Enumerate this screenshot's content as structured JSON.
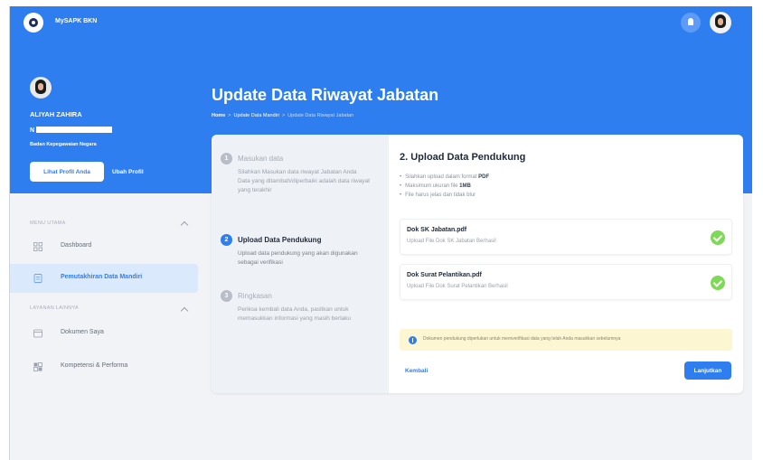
{
  "app": {
    "brand": "MySAPK BKN"
  },
  "profile": {
    "name": "ALIYAH ZAHIRA",
    "id_prefix": "N",
    "org": "Badan Kepegawaian Negara",
    "view_button": "Lihat Profil Anda",
    "edit_button": "Ubah Profil"
  },
  "menu": {
    "section1": "MENU UTAMA",
    "items1": [
      {
        "label": "Dashboard",
        "icon": "grid-icon"
      },
      {
        "label": "Pemutakhiran Data Mandiri",
        "icon": "document-icon",
        "active": true
      }
    ],
    "section2": "LAYANAN LAINNYA",
    "items2": [
      {
        "label": "Dokumen Saya",
        "icon": "folder-icon"
      },
      {
        "label": "Kompetensi & Performa",
        "icon": "chart-icon"
      }
    ]
  },
  "page": {
    "title": "Update Data Riwayat Jabatan",
    "breadcrumb": [
      "Home",
      "Update Data Mandiri",
      "Update Data Riwayat Jabatan"
    ]
  },
  "steps": [
    {
      "num": "1",
      "title": "Masukan data",
      "desc": [
        "Silahkan Masukan data riwayat Jabatan Anda",
        "Data yang ditambah/diperbaiki adalah data riwayat yang terakhir"
      ]
    },
    {
      "num": "2",
      "title": "Upload Data Pendukung",
      "desc": [
        "Upload data pendukung yang akan digunakan sebagai verifikasi"
      ],
      "active": true
    },
    {
      "num": "3",
      "title": "Ringkasan",
      "desc": [
        "Periksa kembali data Anda, pastikan untuk memasukkan informasi yang masih berlaku"
      ]
    }
  ],
  "upload": {
    "title": "2. Upload Data Pendukung",
    "requirements": [
      {
        "text": "Silahkan upload dalam format ",
        "bold": "PDF"
      },
      {
        "text": "Maksimum ukuran file ",
        "bold": "1MB"
      },
      {
        "text": "File harus jelas dan tidak blur",
        "bold": ""
      }
    ],
    "documents": [
      {
        "title": "Dok SK Jabatan.pdf",
        "subtitle": "Upload File Dok SK Jabatan Berhasil",
        "status": "success"
      },
      {
        "title": "Dok Surat Pelantikan.pdf",
        "subtitle": "Upload File Dok Surat Pelantikan Berhasil",
        "status": "success"
      }
    ],
    "notice": "Dokumen pendukung diperlukan untuk memverifikasi data yang telah Anda masukkan sebelumnya",
    "back": "Kembali",
    "next": "Lanjutkan"
  },
  "colors": {
    "primary": "#2f7ef0",
    "success": "#7ed957",
    "notice_bg": "#fdf6d3"
  }
}
